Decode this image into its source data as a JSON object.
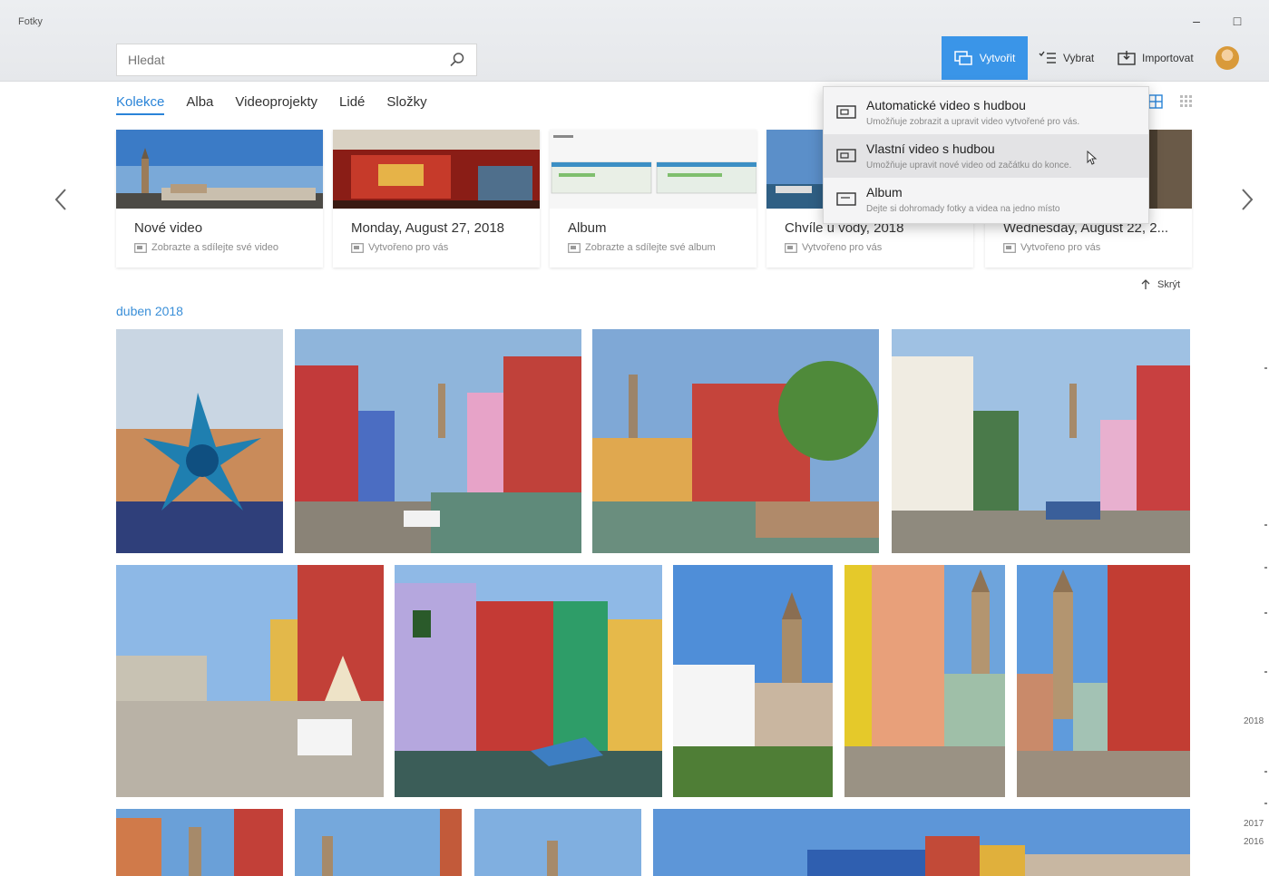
{
  "app": {
    "title": "Fotky"
  },
  "window": {
    "minimize": "–",
    "maximize": "□"
  },
  "search": {
    "placeholder": "Hledat",
    "value": ""
  },
  "toolbar": {
    "create_label": "Vytvořit",
    "select_label": "Vybrat",
    "import_label": "Importovat"
  },
  "tabs": [
    {
      "label": "Kolekce",
      "active": true
    },
    {
      "label": "Alba"
    },
    {
      "label": "Videoprojekty"
    },
    {
      "label": "Lidé"
    },
    {
      "label": "Složky"
    }
  ],
  "cards": [
    {
      "title": "Nové video",
      "subtitle": "Zobrazte a sdílejte své video"
    },
    {
      "title": "Monday, August 27, 2018",
      "subtitle": "Vytvořeno pro vás"
    },
    {
      "title": "Album",
      "subtitle": "Zobrazte a sdílejte své album"
    },
    {
      "title": "Chvíle u vody, 2018",
      "subtitle": "Vytvořeno pro vás"
    },
    {
      "title": "Wednesday, August 22, 2...",
      "subtitle": "Vytvořeno pro vás"
    }
  ],
  "create_menu": [
    {
      "title": "Automatické video s hudbou",
      "description": "Umožňuje zobrazit a upravit video vytvořené pro vás."
    },
    {
      "title": "Vlastní video s hudbou",
      "description": "Umožňuje upravit nové video od začátku do konce."
    },
    {
      "title": "Album",
      "description": "Dejte si dohromady fotky a videa na jedno místo"
    }
  ],
  "hide_label": "Skrýt",
  "section": {
    "date": "duben 2018"
  },
  "timeline": [
    "2018",
    "2017",
    "2016"
  ]
}
